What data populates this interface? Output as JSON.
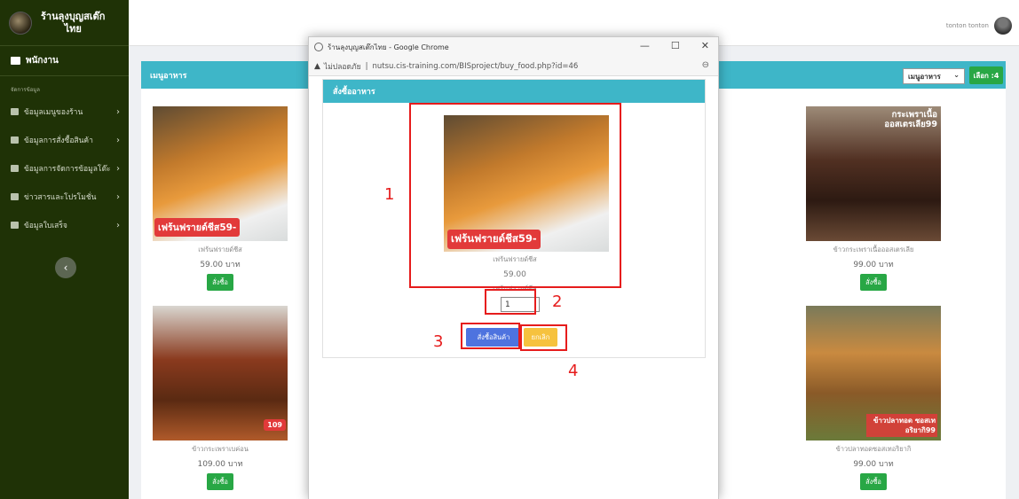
{
  "sidebar": {
    "brand_line1": "ร้านลุงบุญสเต๊ก",
    "brand_line2": "ไทย",
    "dashboard_label": "พนักงาน",
    "section_label": "จัดการข้อมูล",
    "items": [
      {
        "label": "ข้อมูลเมนูของร้าน",
        "icon": "table-icon"
      },
      {
        "label": "ข้อมูลการสั่งซื้อสินค้า",
        "icon": "trash-icon"
      },
      {
        "label": "ข้อมูลการจัดการข้อมูลโต๊ะ",
        "icon": "table-icon"
      },
      {
        "label": "ข่าวสารและโปรโมชั่น",
        "icon": "megaphone-icon"
      },
      {
        "label": "ข้อมูลใบเสร็จ",
        "icon": "receipt-icon"
      }
    ],
    "collapse_glyph": "‹"
  },
  "topbar": {
    "user_name": "tonton tonton"
  },
  "main": {
    "header_title": "เมนูอาหาร",
    "select_value": "เมนูอาหาร",
    "select_arrow": "⌄",
    "count_label": "เลือก :4",
    "products": [
      {
        "name": "เฟร้นฟรายด์ชีส",
        "price": "59.00 บาท",
        "order_label": "สั่งซื้อ",
        "tag": "เฟร้นฟรายด์ชีส59-"
      },
      {
        "name": "ข้าวกระเพราเนื้อออสเตรเลีย",
        "price": "99.00 บาท",
        "order_label": "สั่งซื้อ",
        "tag": "กระเพราเนื้อ ออสเตรเลีย99"
      },
      {
        "name": "ข้าวกระเพราเบค่อน",
        "price": "109.00 บาท",
        "order_label": "สั่งซื้อ",
        "tag": "109"
      },
      {
        "name": "ข้าวปลาทอดซอสเทอริยากิ",
        "price": "99.00 บาท",
        "order_label": "สั่งซื้อ",
        "tag": "ข้าวปลาทอด ซอสเทอริยากิ99"
      }
    ]
  },
  "popup": {
    "window_title": "ร้านลุงบุญสเต๊กไทย - Google Chrome",
    "win_minimize": "—",
    "win_maximize": "☐",
    "win_close": "✕",
    "address_warning": "ไม่ปลอดภัย",
    "address_separator": "|",
    "address_url": "nutsu.cis-training.com/BISproject/buy_food.php?id=46",
    "order_header": "สั่งซื้ออาหาร",
    "product_tag": "เฟร้นฟรายด์ชีส59-",
    "product_name": "เฟร้นฟรายด์ชีส",
    "product_price": "59.00",
    "product_desc": "เฟร้นฟรายด์ชีส",
    "quantity": "1",
    "order_button": "สั่งซื้อสินค้า",
    "cancel_button": "ยกเลิก"
  },
  "annotations": [
    "1",
    "2",
    "3",
    "4"
  ],
  "colors": {
    "sidebar_bg": "#1f3206",
    "header_teal": "#3eb6c8",
    "order_green": "#28a745",
    "order_blue": "#4e73df",
    "cancel_yellow": "#f6c23e",
    "annotation_red": "#e61c1c"
  }
}
